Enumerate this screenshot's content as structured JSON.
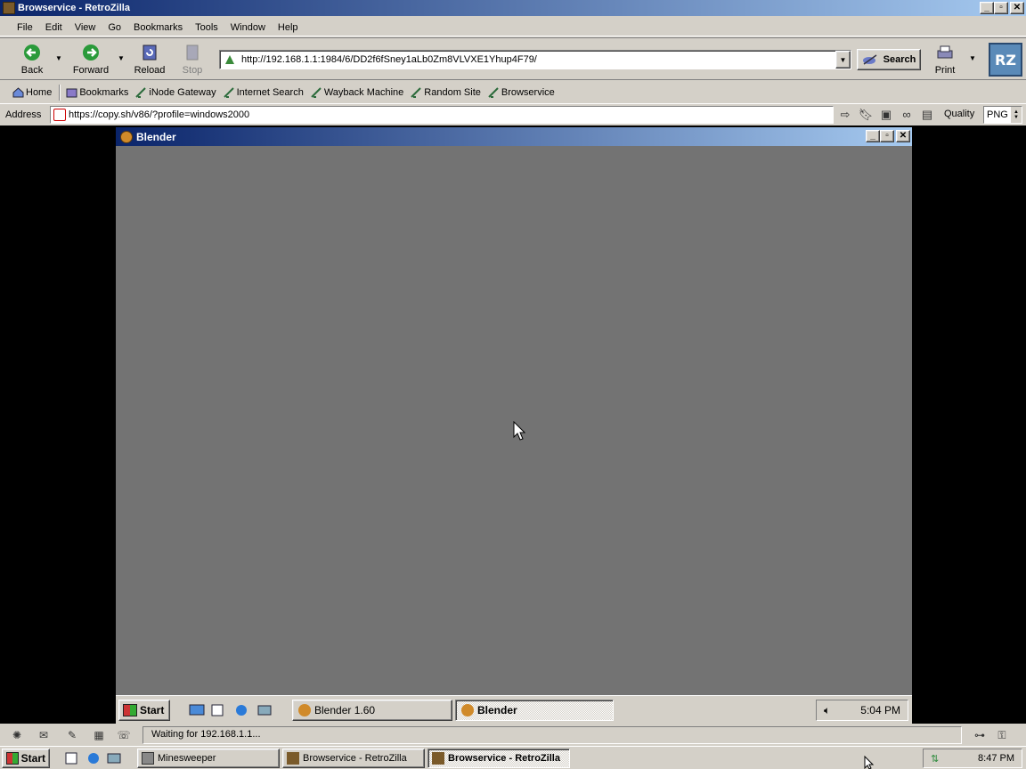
{
  "window": {
    "title": "Browservice - RetroZilla",
    "min": "_",
    "max": "▫",
    "close": "✕"
  },
  "menu": [
    "File",
    "Edit",
    "View",
    "Go",
    "Bookmarks",
    "Tools",
    "Window",
    "Help"
  ],
  "nav": {
    "back": "Back",
    "forward": "Forward",
    "reload": "Reload",
    "stop": "Stop",
    "print": "Print",
    "url": "http://192.168.1.1:1984/6/DD2f6fSney1aLb0Zm8VLVXE1Yhup4F79/",
    "search": "Search",
    "logo": "RZ"
  },
  "bookmarks": [
    "Home",
    "Bookmarks",
    "iNode Gateway",
    "Internet Search",
    "Wayback Machine",
    "Random Site",
    "Browservice"
  ],
  "address": {
    "label": "Address",
    "value": "https://copy.sh/v86/?profile=windows2000",
    "quality_label": "Quality",
    "quality_value": "PNG"
  },
  "inner": {
    "title": "Blender",
    "start": "Start",
    "task1": "Blender 1.60",
    "task2": "Blender",
    "clock": "5:04 PM"
  },
  "status": {
    "text": "Waiting for 192.168.1.1..."
  },
  "taskbar": {
    "start": "Start",
    "task1": "Minesweeper",
    "task2": "Browservice - RetroZilla",
    "task3": "Browservice - RetroZilla",
    "clock": "8:47 PM"
  },
  "colors": {
    "titlebar_start": "#0a246a",
    "titlebar_end": "#a6caf0",
    "chrome": "#d4d0c8",
    "canvas": "#737373"
  }
}
